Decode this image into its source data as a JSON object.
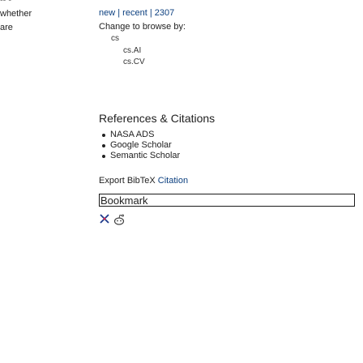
{
  "main": {
    "fragments": [
      {
        "text": "whether"
      },
      {
        "text": "are"
      }
    ]
  },
  "sidebar": {
    "top_partial": "• • • • •",
    "nav": {
      "new": "new",
      "sep1": "|",
      "recent": "recent",
      "sep2": "|",
      "month": "2307"
    },
    "browse_label": "Change to browse by:",
    "browse_category": "cs",
    "browse_subs": [
      "cs.AI",
      "cs.CV"
    ],
    "refs_title": "References & Citations",
    "refs": [
      "NASA ADS",
      "Google Scholar",
      "Semantic Scholar"
    ],
    "export_prefix": "Export BibTeX",
    "export_citation": "Citation",
    "bookmark_label": "Bookmark",
    "icons": [
      "bibsonomy-icon",
      "reddit-icon"
    ]
  },
  "colors": {
    "link": "#0b3f7f",
    "text": "#222222",
    "border": "#1a1a1a"
  }
}
